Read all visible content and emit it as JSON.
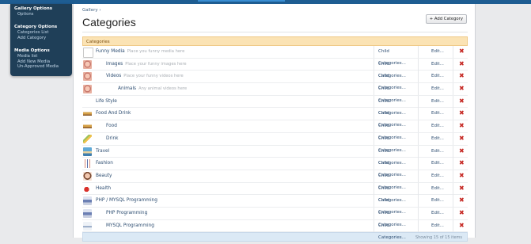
{
  "sidebar": {
    "groups": [
      {
        "title": "Gallery Options",
        "items": [
          "Options"
        ]
      },
      {
        "title": "Category Options",
        "items": [
          "Categories List",
          "Add Category"
        ]
      },
      {
        "title": "Media Options",
        "items": [
          "Media list",
          "Add New Media",
          "Un-Approved Media"
        ]
      }
    ]
  },
  "breadcrumb": "Gallery ›",
  "page_title": "Categories",
  "add_button": "+ Add Category",
  "table_header": "Categories",
  "rows": [
    {
      "name": "Funny Media",
      "desc": "Place you funny media here",
      "indent": 0,
      "thumb": "broken"
    },
    {
      "name": "Images",
      "desc": "Place your funny images here",
      "indent": 1,
      "thumb": "face"
    },
    {
      "name": "Videos",
      "desc": "Place your funny videos here",
      "indent": 1,
      "thumb": "face"
    },
    {
      "name": "Animals",
      "desc": "Any animal videos here",
      "indent": 2,
      "thumb": "face"
    },
    {
      "name": "Life Style",
      "desc": "",
      "indent": 0,
      "thumb": "none"
    },
    {
      "name": "Food And Drink",
      "desc": "",
      "indent": 0,
      "thumb": "food"
    },
    {
      "name": "Food",
      "desc": "",
      "indent": 1,
      "thumb": "food"
    },
    {
      "name": "Drink",
      "desc": "",
      "indent": 1,
      "thumb": "drink"
    },
    {
      "name": "Travel",
      "desc": "",
      "indent": 0,
      "thumb": "travel"
    },
    {
      "name": "Fashion",
      "desc": "",
      "indent": 0,
      "thumb": "fashion"
    },
    {
      "name": "Beauty",
      "desc": "",
      "indent": 0,
      "thumb": "beauty"
    },
    {
      "name": "Health",
      "desc": "",
      "indent": 0,
      "thumb": "health"
    },
    {
      "name": "PHP / MYSQL Programming",
      "desc": "",
      "indent": 0,
      "thumb": "php"
    },
    {
      "name": "PHP Programming",
      "desc": "",
      "indent": 1,
      "thumb": "php"
    },
    {
      "name": "MYSQL Programming",
      "desc": "",
      "indent": 1,
      "thumb": "mysql"
    }
  ],
  "child_label": "Child Categories...",
  "edit_label": "Edit...",
  "delete_glyph": "✖",
  "footer": "Showing 15 of 15 items",
  "colors": {
    "sidebar_bg": "#1f3f58",
    "header_bg": "#fbe3b4",
    "link": "#2d4d71",
    "delete": "#c62a25"
  }
}
